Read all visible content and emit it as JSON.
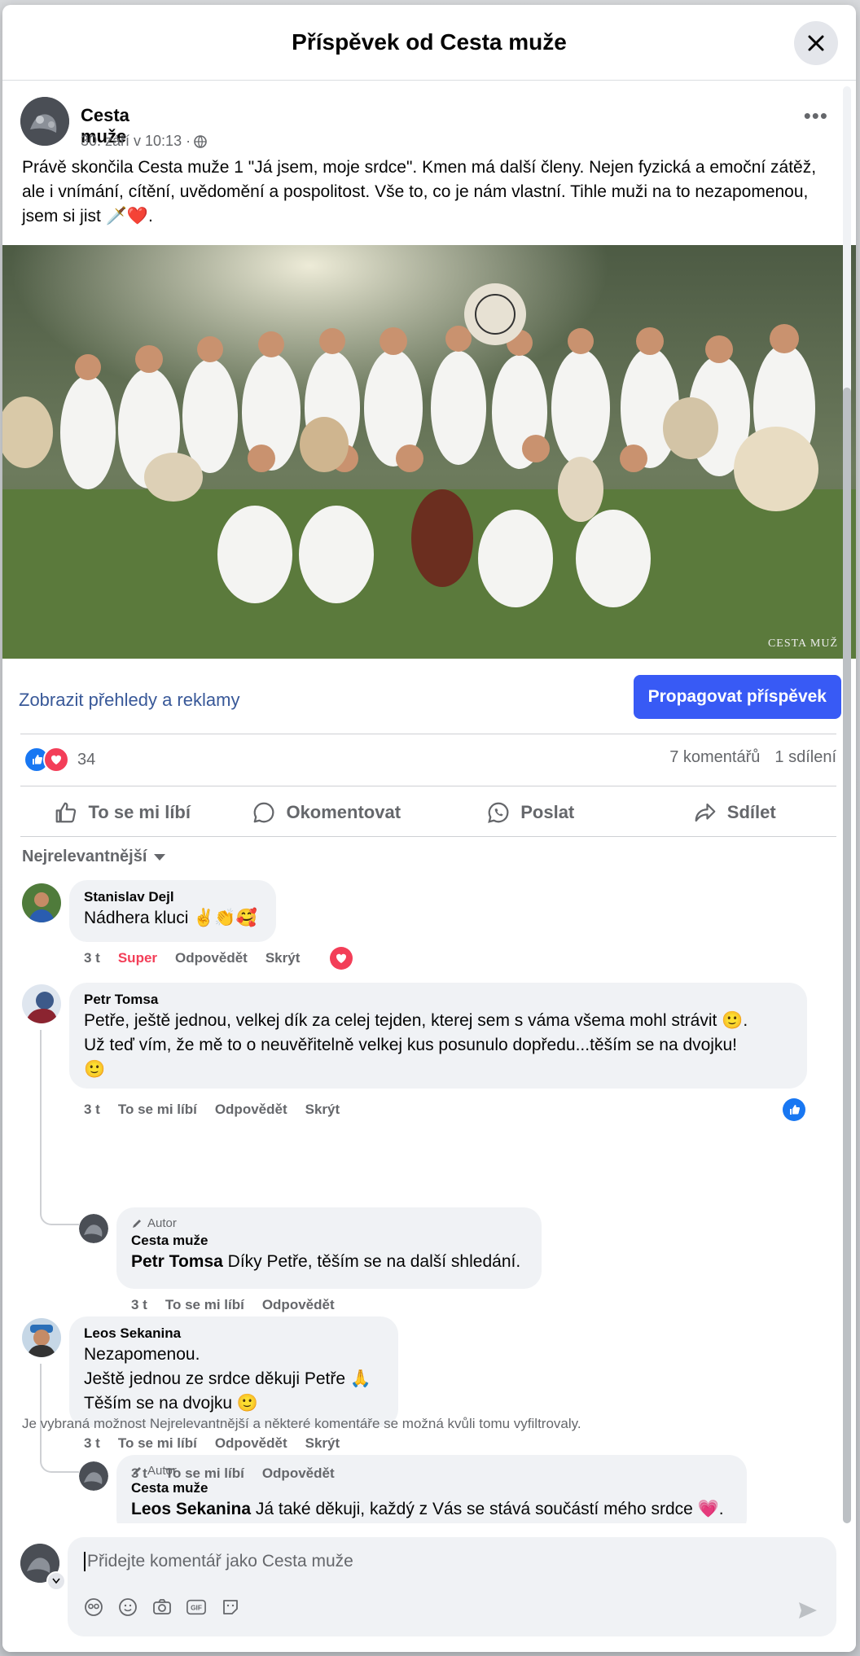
{
  "modal": {
    "title": "Příspěvek od Cesta muže"
  },
  "post": {
    "author": "Cesta muže",
    "date": "30. září v 10:13 ·",
    "text": "Právě skončila Cesta muže 1  \"Já jsem, moje srdce\". Kmen má další členy. Nejen fyzická a emoční zátěž, ale i vnímání, cítění, uvědomění a pospolitost. Vše to, co je nám vlastní. Tihle muži na to nezapomenou, jsem si jist 🗡️❤️.",
    "photo_watermark": "CESTA MUŽ",
    "insights_link": "Zobrazit přehledy a reklamy",
    "promote_button": "Propagovat příspěvek",
    "reaction_count": "34",
    "comments_count": "7 komentářů",
    "shares_count": "1 sdílení"
  },
  "actions": {
    "like": "To se mi líbí",
    "comment": "Okomentovat",
    "send": "Poslat",
    "share": "Sdílet"
  },
  "sort_label": "Nejrelevantnější",
  "comments": [
    {
      "name": "Stanislav Dejl",
      "text": "Nádhera kluci ✌️👏🥰",
      "time": "3 t",
      "reaction_label": "Super",
      "reply": "Odpovědět",
      "hide": "Skrýt"
    },
    {
      "name": "Petr Tomsa",
      "text_line1": "Petře, ještě jednou, velkej dík za celej tejden, kterej sem s váma všema mohl strávit 🙂.",
      "text_line2": "Už teď vím, že mě to o neuvěřitelně velkej kus posunulo dopředu...těším se na dvojku!",
      "text_line3": "🙂",
      "time": "3 t",
      "like": "To se mi líbí",
      "reply": "Odpovědět",
      "hide": "Skrýt",
      "response": {
        "badge": "Autor",
        "name": "Cesta muže",
        "tag": "Petr Tomsa",
        "text": " Díky Petře, těším se na další shledání.",
        "time": "3 t",
        "like": "To se mi líbí",
        "reply": "Odpovědět"
      }
    },
    {
      "name": "Leos Sekanina",
      "text_line1": "Nezapomenou.",
      "text_line2": "Ještě jednou ze srdce děkuji Petře 🙏",
      "text_line3": "Těším se na dvojku 🙂",
      "time": "3 t",
      "like": "To se mi líbí",
      "reply": "Odpovědět",
      "hide": "Skrýt",
      "response": {
        "badge": "Autor",
        "name": "Cesta muže",
        "tag": "Leos Sekanina",
        "text": " Já také děkuji, každý z Vás se stává součástí mého srdce 💗.",
        "time": "3 t",
        "like": "To se mi líbí",
        "reply": "Odpovědět"
      }
    }
  ],
  "filter_note": "Je vybraná možnost Nejrelevantnější a některé komentáře se možná kvůli tomu vyfiltrovaly.",
  "composer": {
    "placeholder": "Přidejte komentář jako Cesta muže"
  },
  "colors": {
    "primary": "#385af5",
    "link": "#385898",
    "love": "#f33e58",
    "like": "#1877f2"
  }
}
